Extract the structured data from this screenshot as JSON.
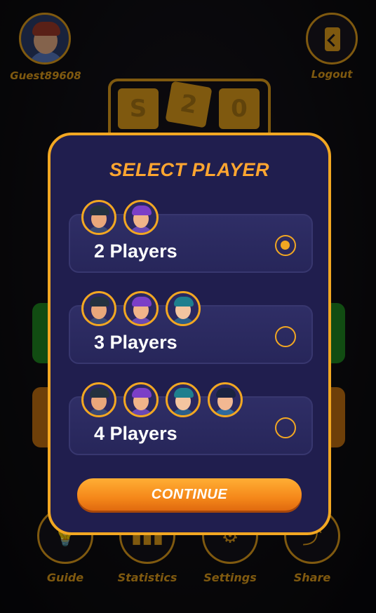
{
  "background": {
    "username": "Guest89608",
    "logout_label": "Logout",
    "logo_tiles": [
      "S",
      "2",
      "0"
    ],
    "bottom_nav": [
      {
        "label": "Guide",
        "icon": "bulb-icon"
      },
      {
        "label": "Statistics",
        "icon": "bar-chart-icon"
      },
      {
        "label": "Settings",
        "icon": "gear-icon"
      },
      {
        "label": "Share",
        "icon": "share-icon"
      }
    ]
  },
  "modal": {
    "title": "SELECT PLAYER",
    "options": [
      {
        "label": "2 Players",
        "players": 2,
        "selected": true
      },
      {
        "label": "3 Players",
        "players": 3,
        "selected": false
      },
      {
        "label": "4 Players",
        "players": 4,
        "selected": false
      }
    ],
    "continue_label": "CONTINUE"
  },
  "colors": {
    "accent": "#f2a722",
    "modal_bg": "#201e4e",
    "option_bg": "#2f2e66",
    "button_orange": "#f5881a"
  },
  "player_avatars": [
    {
      "name": "bearded-man-avatar",
      "skin": "#e9a77b",
      "hair": "#23323f",
      "body": "#3b4a74"
    },
    {
      "name": "purple-hair-woman-avatar",
      "skin": "#f0b48a",
      "hair": "#7b3fc7",
      "body": "#6a49b5"
    },
    {
      "name": "teal-hair-glasses-avatar",
      "skin": "#f3c5a0",
      "hair": "#1e7f8e",
      "body": "#2b5f8a"
    },
    {
      "name": "dark-hair-man-avatar",
      "skin": "#f2b892",
      "hair": "#1a2340",
      "body": "#2e6a9e"
    }
  ]
}
